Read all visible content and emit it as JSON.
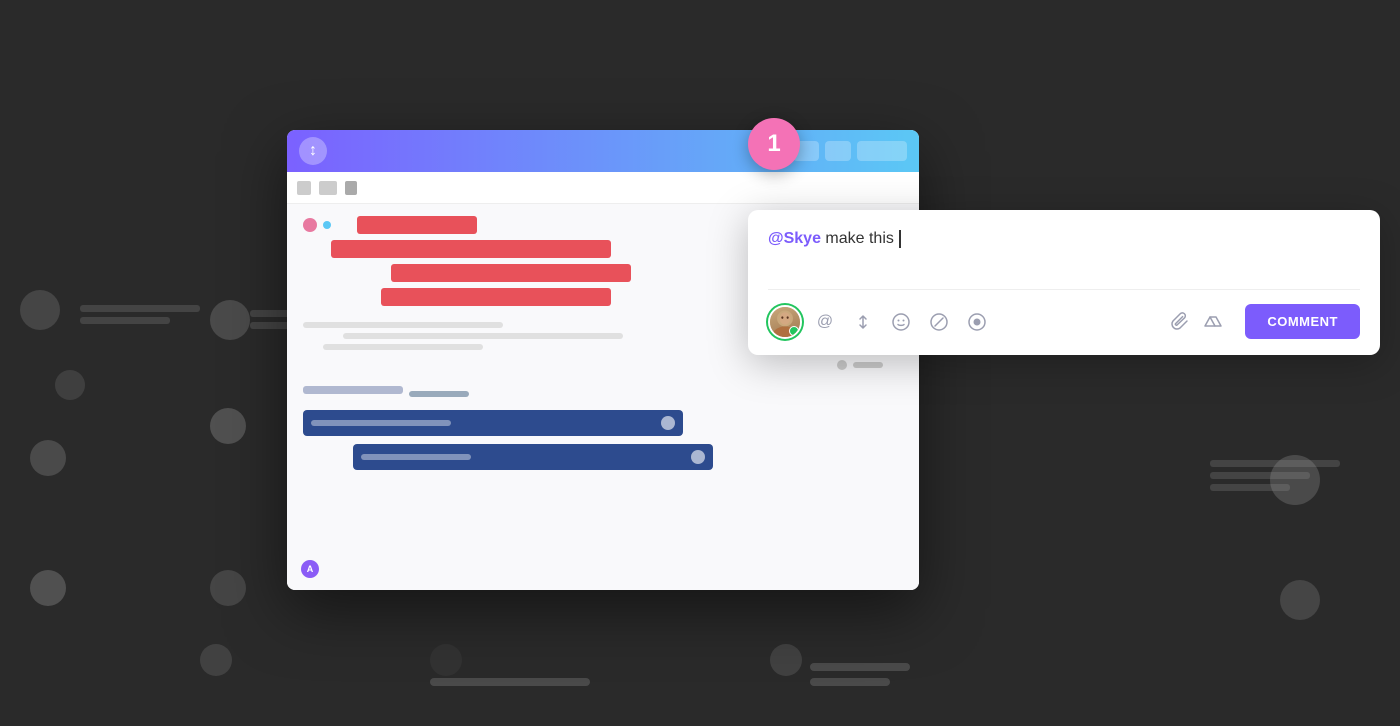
{
  "background": {
    "color": "#2a2a2a"
  },
  "notification_badge": {
    "number": "1",
    "color": "#f472b6"
  },
  "app_card": {
    "header": {
      "logo": "↕",
      "gradient_start": "#7b61ff",
      "gradient_end": "#5bc8f5"
    },
    "toolbar": {
      "icons": [
        "grid-icon",
        "users-icon",
        "add-icon"
      ]
    },
    "tasks": {
      "red_section_label": "",
      "blue_section_label": ""
    }
  },
  "comment_card": {
    "mention": "@Skye",
    "text": " make this ",
    "cursor": "|",
    "avatar_alt": "User avatar",
    "tools": [
      {
        "name": "at-icon",
        "symbol": "@"
      },
      {
        "name": "arrows-icon",
        "symbol": "⇅"
      },
      {
        "name": "emoji-icon",
        "symbol": "☺"
      },
      {
        "name": "slash-icon",
        "symbol": "⊘"
      },
      {
        "name": "circle-icon",
        "symbol": "◉"
      },
      {
        "name": "attachment-icon",
        "symbol": "📎"
      },
      {
        "name": "drive-icon",
        "symbol": "▲"
      }
    ],
    "comment_button_label": "COMMENT",
    "comment_button_color": "#7c5cfc"
  }
}
